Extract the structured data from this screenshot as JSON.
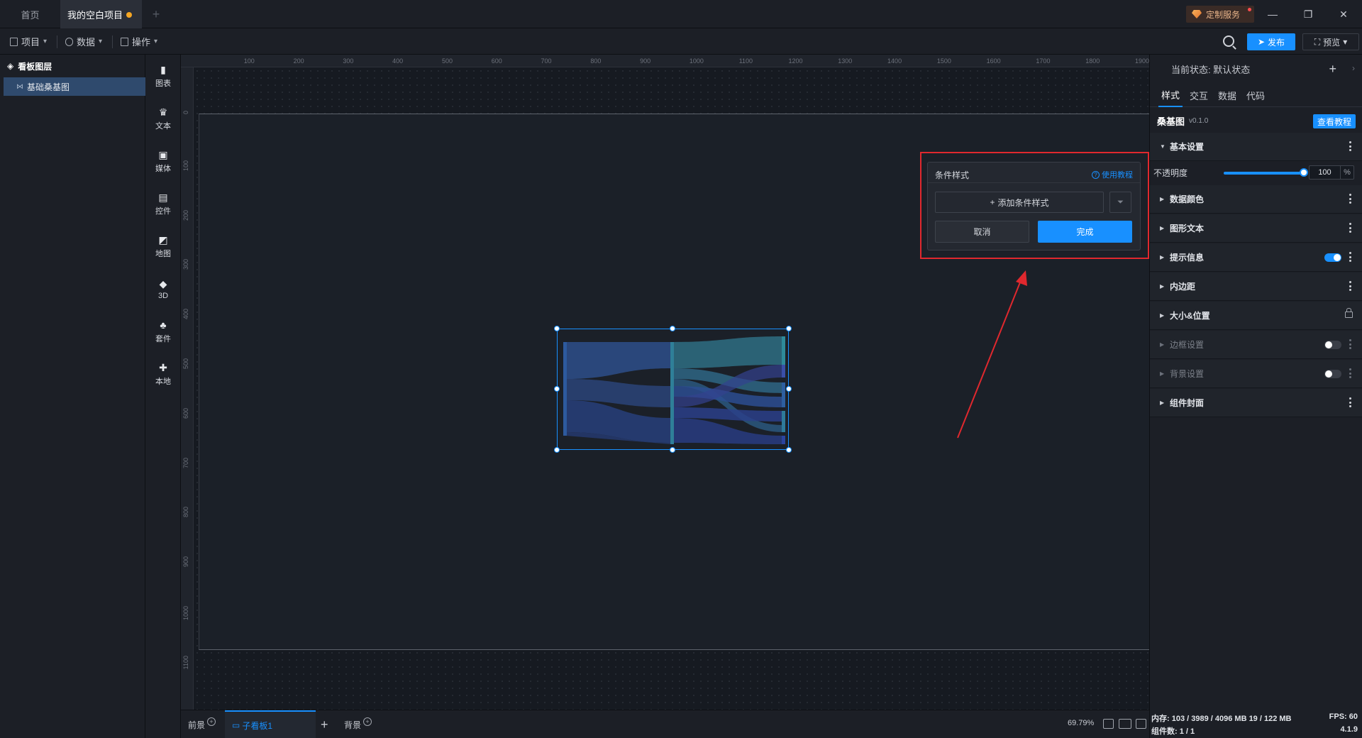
{
  "titlebar": {
    "home_tab": "首页",
    "project_tab": "我的空白项目",
    "custom_service": "定制服务"
  },
  "toolbar": {
    "menus": [
      "项目",
      "数据",
      "操作"
    ],
    "publish_label": "发布",
    "preview_label": "预览"
  },
  "layers": {
    "header": "看板图层",
    "items": [
      "基础桑基图"
    ]
  },
  "rail": {
    "items": [
      "图表",
      "文本",
      "媒体",
      "控件",
      "地图",
      "3D",
      "套件",
      "本地"
    ]
  },
  "ruler": {
    "top_ticks": [
      "100",
      "200",
      "300",
      "400",
      "500",
      "600",
      "700",
      "800",
      "900",
      "1000",
      "1100",
      "1200",
      "1300",
      "1400",
      "1500",
      "1600",
      "1700",
      "1800",
      "1900"
    ],
    "left_ticks": [
      "0",
      "100",
      "200",
      "300",
      "400",
      "500",
      "600",
      "700",
      "800",
      "900",
      "1000",
      "1100"
    ]
  },
  "popup": {
    "title": "条件样式",
    "help": "使用教程",
    "add_condition": "添加条件样式",
    "cancel": "取消",
    "done": "完成"
  },
  "props": {
    "state_label": "当前状态: 默认状态",
    "tabs": [
      "样式",
      "交互",
      "数据",
      "代码"
    ],
    "component_name": "桑基图",
    "component_version": "v0.1.0",
    "tutorial_btn": "查看教程",
    "opacity_label": "不透明度",
    "opacity_value": "100",
    "opacity_unit": "%",
    "sections": [
      "基本设置",
      "数据颜色",
      "图形文本",
      "提示信息",
      "内边距",
      "大小&位置",
      "边框设置",
      "背景设置",
      "组件封面"
    ]
  },
  "bottombar": {
    "foreground": "前景",
    "subboard": "子看板1",
    "background": "背景",
    "zoom": "69.79%"
  },
  "status": {
    "memory": "内存: 103 / 3989 / 4096 MB 19 / 122 MB",
    "fps": "FPS: 60",
    "component_count": "组件数: 1 / 1",
    "version": "4.1.9"
  },
  "colors": {
    "accent": "#1890ff",
    "highlight": "#e0282e",
    "sankey_left": "#2d5a9e",
    "sankey_right": "#2e8a9a"
  }
}
